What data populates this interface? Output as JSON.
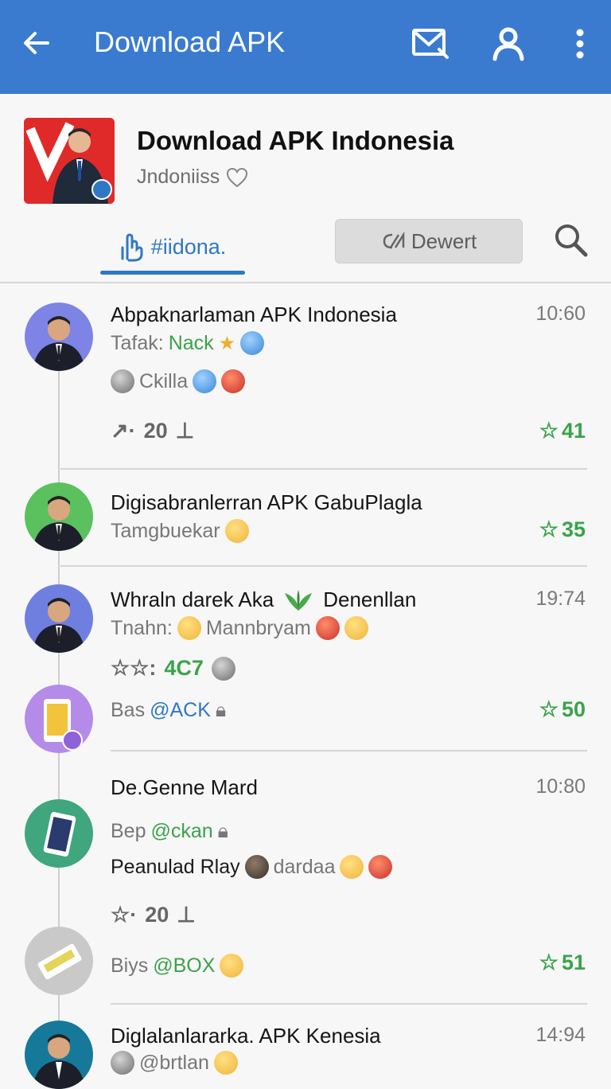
{
  "appbar": {
    "title": "Download APK"
  },
  "profile": {
    "name": "Download APK Indonesia",
    "subtitle": "Jndoniiss",
    "tab_active": "#iidona.",
    "pill_label": "Dewert"
  },
  "posts": [
    {
      "name": "Abpaknarlaman APK Indonesia",
      "time": "10:60",
      "line1_prefix": "Tafak:",
      "line1_value": "Nack",
      "line2": "Ckilla",
      "stat": "20",
      "stars": "41"
    },
    {
      "name": "Digisabranlerran APK GabuPlagla",
      "line1": "Tamgbuekar",
      "stars": "35"
    },
    {
      "name": "Whraln darek Aka",
      "name2": "Denenllan",
      "time": "19:74",
      "line1_prefix": "Tnahn:",
      "line1_value": "Mannbryam",
      "stat": "4C7"
    },
    {
      "line1_prefix": "Bas",
      "line1_value": "@ACK",
      "stars": "50"
    },
    {
      "name": "De.Genne Mard",
      "time": "10:80",
      "line1_prefix": "Bep",
      "line1_value": "@ckan",
      "line2_prefix": "Peanulad Rlay",
      "line2_value": "dardaa",
      "stat": "20"
    },
    {
      "line1_prefix": "Biys",
      "line1_value": "@BOX",
      "stars": "51"
    },
    {
      "name": "Diglalanlararka. APK Kenesia",
      "time": "14:94",
      "line1": "@brtlan"
    }
  ],
  "colors": {
    "appbar": "#3a7bd0",
    "accent": "#2f78c4",
    "green": "#3aa34a"
  },
  "icons": [
    "back-arrow-icon",
    "mail-icon",
    "user-icon",
    "more-vert-icon",
    "hand-icon",
    "heart-icon",
    "chat-icon",
    "search-icon",
    "star-icon",
    "thumbs-icon",
    "lock-icon"
  ]
}
